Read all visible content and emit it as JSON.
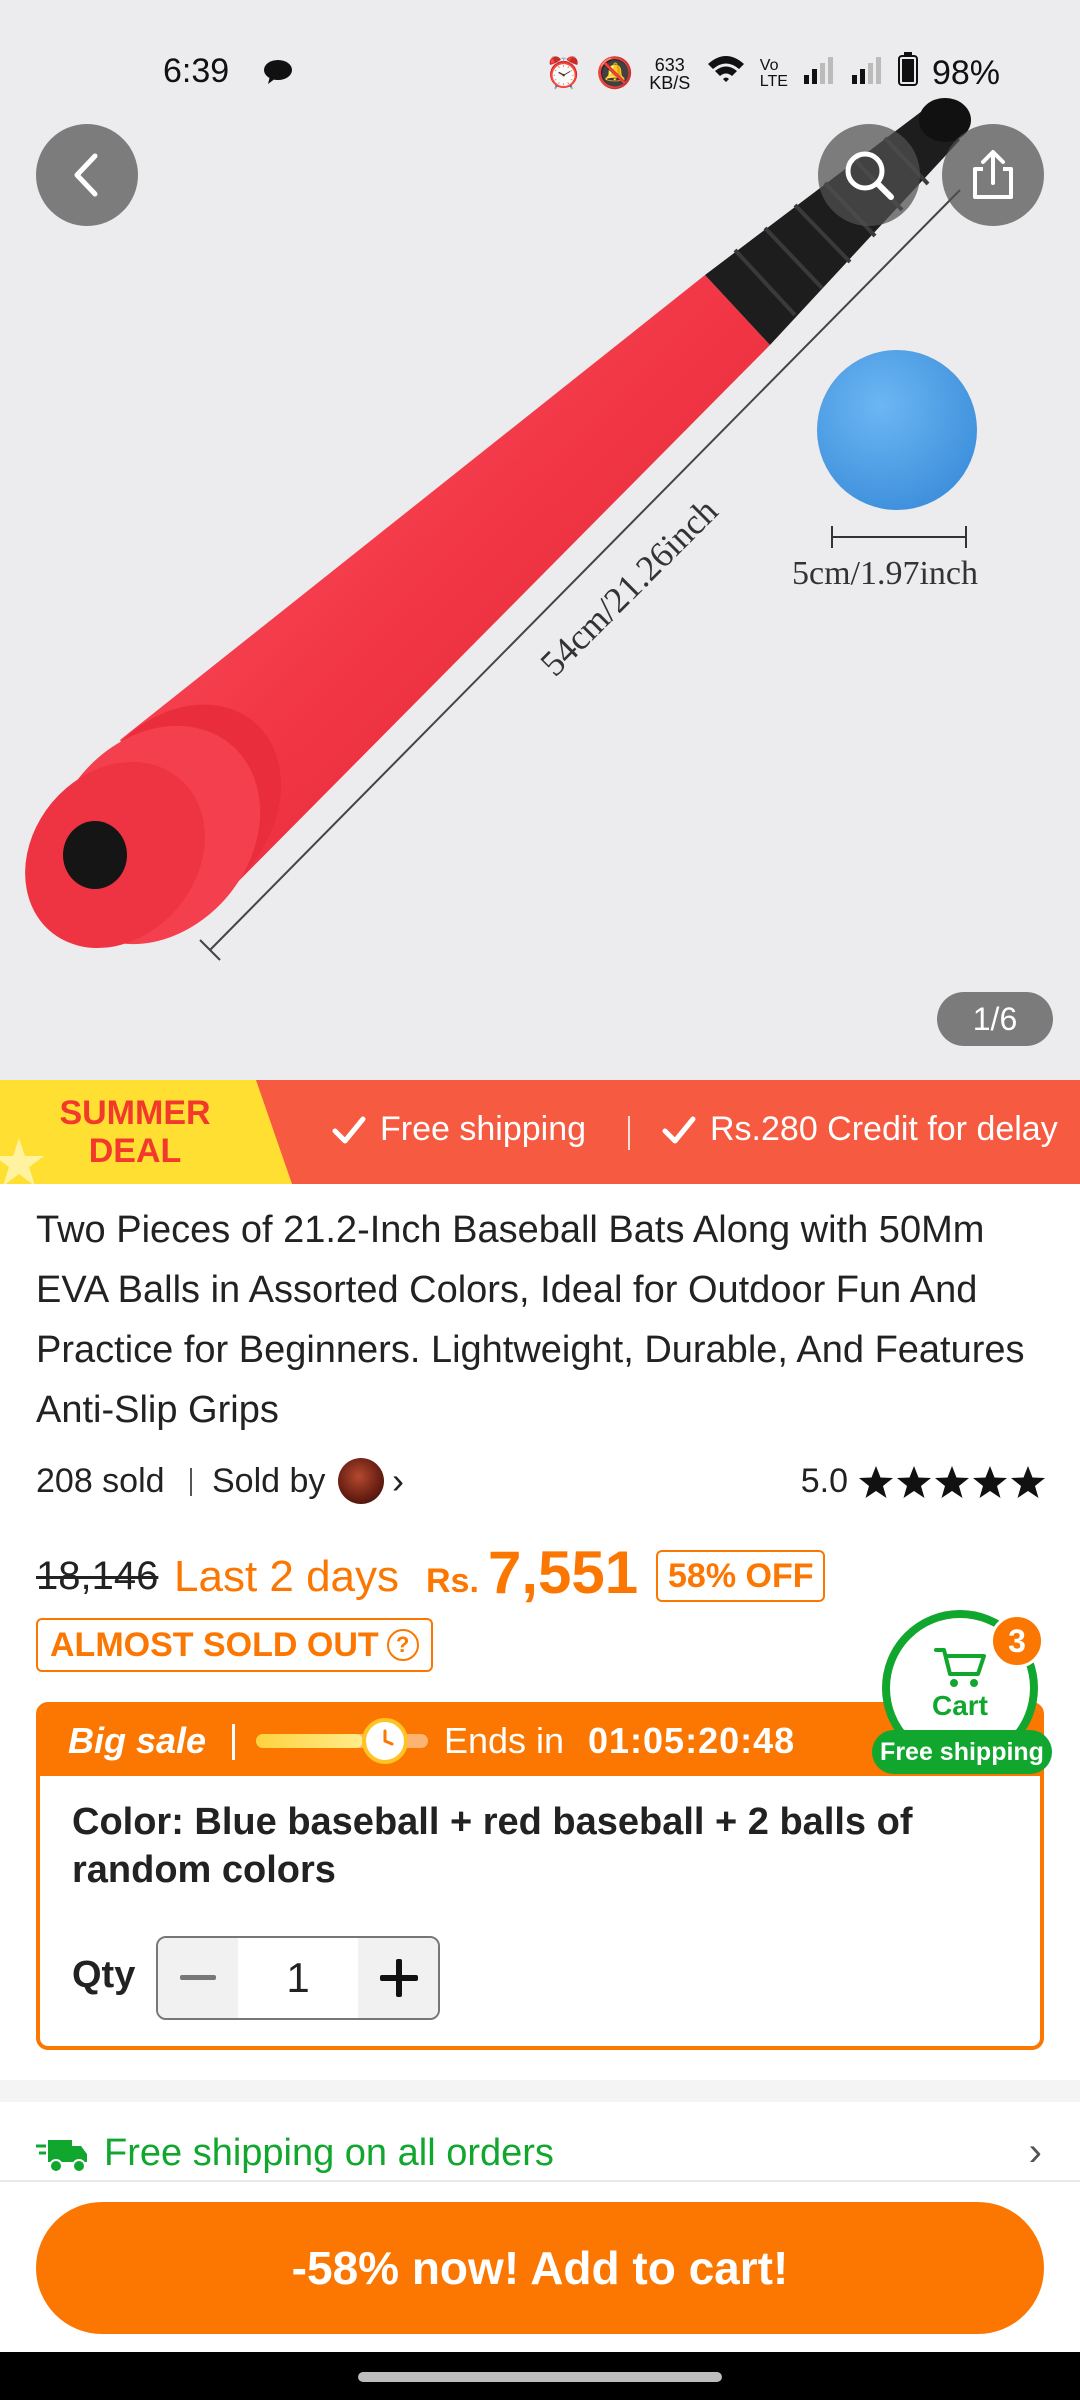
{
  "status_bar": {
    "time": "6:39",
    "net_speed": "633 KB/S",
    "battery": "98%"
  },
  "gallery": {
    "pager": "1/6",
    "bat_dimension": "54cm/21.26inch",
    "ball_dimension": "5cm/1.97inch",
    "bat_color": "#f3394a",
    "ball_color": "#4a9ee8"
  },
  "banner": {
    "deal_line1": "SUMMER",
    "deal_line2": "DEAL",
    "feature1": "Free shipping",
    "feature2": "Rs.280 Credit for delay"
  },
  "product": {
    "title": "Two Pieces of 21.2-Inch Baseball Bats Along with 50Mm EVA Balls in Assorted Colors, Ideal for Outdoor Fun And Practice for Beginners. Lightweight, Durable, And Features Anti-Slip Grips",
    "sold": "208 sold",
    "sold_by": "Sold by",
    "rating": "5.0",
    "stars": 5
  },
  "price": {
    "original": "18,146",
    "last_days": "Last 2 days",
    "currency": "Rs.",
    "current": "7,551",
    "discount": "58% OFF",
    "almost_sold_out": "ALMOST SOLD OUT"
  },
  "cart": {
    "count": "3",
    "label": "Cart",
    "free_shipping": "Free shipping"
  },
  "sale": {
    "label": "Big sale",
    "ends_label": "Ends in",
    "countdown": "01:05:20:48",
    "progress": 0.62,
    "color_text": "Color: Blue baseball + red baseball + 2 balls of random colors",
    "qty_label": "Qty",
    "qty_value": "1"
  },
  "shipping": {
    "text": "Free shipping on all orders"
  },
  "cta": {
    "label": "-58% now! Add to cart!"
  },
  "colors": {
    "accent_orange": "#fb7701",
    "banner_red": "#f65a41",
    "deal_yellow": "#ffe032",
    "green": "#11a72f"
  }
}
